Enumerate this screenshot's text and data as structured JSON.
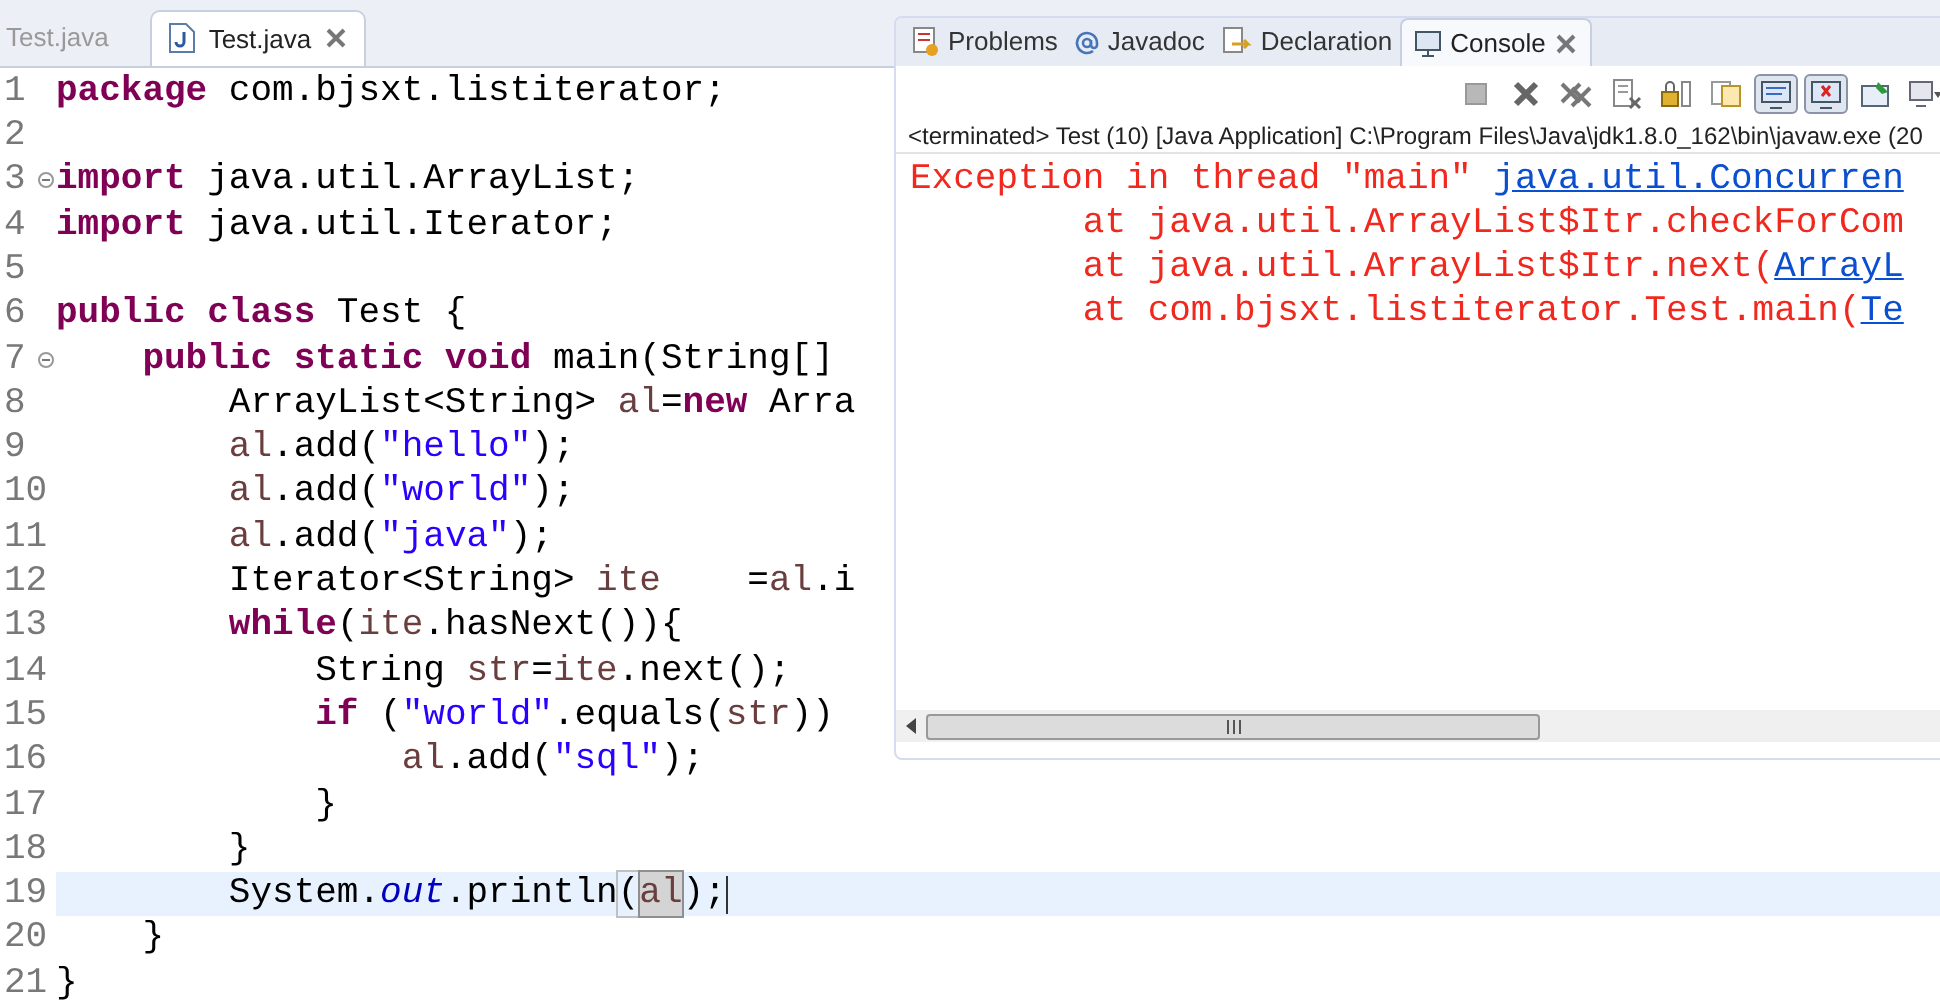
{
  "editor": {
    "tabs": [
      {
        "label": "Test.java",
        "selected": false
      },
      {
        "label": "Test.java",
        "selected": true
      }
    ],
    "lines": [
      {
        "number": "1",
        "fold": false,
        "current": false,
        "tokens": [
          {
            "kind": "keyword",
            "text": "package"
          },
          {
            "kind": "plain",
            "text": " com.bjsxt.listiterator;"
          }
        ]
      },
      {
        "number": "2",
        "fold": false,
        "current": false
      },
      {
        "number": "3",
        "fold": true,
        "current": false,
        "tokens": [
          {
            "kind": "keyword",
            "text": "import"
          },
          {
            "kind": "plain",
            "text": " java.util.ArrayList;"
          }
        ]
      },
      {
        "number": "4",
        "fold": false,
        "current": false,
        "tokens": [
          {
            "kind": "keyword",
            "text": "import"
          },
          {
            "kind": "plain",
            "text": " java.util.Iterator;"
          }
        ]
      },
      {
        "number": "5",
        "fold": false,
        "current": false
      },
      {
        "number": "6",
        "fold": false,
        "current": false,
        "tokens": [
          {
            "kind": "keyword",
            "text": "public class"
          },
          {
            "kind": "plain",
            "text": " Test {"
          }
        ]
      },
      {
        "number": "7",
        "fold": true,
        "current": false,
        "tokens": [
          {
            "kind": "keyword",
            "text": "    public static void"
          },
          {
            "kind": "plain",
            "text": " main(String[]"
          }
        ]
      },
      {
        "number": "8",
        "fold": false,
        "current": false,
        "tokens": [
          {
            "kind": "plain",
            "text": "        ArrayList<String> "
          },
          {
            "kind": "local",
            "text": "al"
          },
          {
            "kind": "plain",
            "text": "="
          },
          {
            "kind": "keyword",
            "text": "new"
          },
          {
            "kind": "plain",
            "text": " Arra"
          }
        ]
      },
      {
        "number": "9",
        "fold": false,
        "current": false,
        "tokens": [
          {
            "kind": "local",
            "text": "        al"
          },
          {
            "kind": "plain",
            "text": ".add("
          },
          {
            "kind": "string",
            "text": "\"hello\""
          },
          {
            "kind": "plain",
            "text": ");"
          }
        ]
      },
      {
        "number": "10",
        "fold": false,
        "current": false,
        "tokens": [
          {
            "kind": "local",
            "text": "        al"
          },
          {
            "kind": "plain",
            "text": ".add("
          },
          {
            "kind": "string",
            "text": "\"world\""
          },
          {
            "kind": "plain",
            "text": ");"
          }
        ]
      },
      {
        "number": "11",
        "fold": false,
        "current": false,
        "tokens": [
          {
            "kind": "local",
            "text": "        al"
          },
          {
            "kind": "plain",
            "text": ".add("
          },
          {
            "kind": "string",
            "text": "\"java\""
          },
          {
            "kind": "plain",
            "text": ");"
          }
        ]
      },
      {
        "number": "12",
        "fold": false,
        "current": false,
        "tokens": [
          {
            "kind": "plain",
            "text": "        Iterator<String> "
          },
          {
            "kind": "local",
            "text": "ite"
          },
          {
            "kind": "plain",
            "text": "    ="
          },
          {
            "kind": "local",
            "text": "al"
          },
          {
            "kind": "plain",
            "text": ".i"
          }
        ]
      },
      {
        "number": "13",
        "fold": false,
        "current": false,
        "tokens": [
          {
            "kind": "keyword",
            "text": "        while"
          },
          {
            "kind": "plain",
            "text": "("
          },
          {
            "kind": "local",
            "text": "ite"
          },
          {
            "kind": "plain",
            "text": ".hasNext()){"
          }
        ]
      },
      {
        "number": "14",
        "fold": false,
        "current": false,
        "tokens": [
          {
            "kind": "plain",
            "text": "            String "
          },
          {
            "kind": "local",
            "text": "str"
          },
          {
            "kind": "plain",
            "text": "="
          },
          {
            "kind": "local",
            "text": "ite"
          },
          {
            "kind": "plain",
            "text": ".next();"
          }
        ]
      },
      {
        "number": "15",
        "fold": false,
        "current": false,
        "tokens": [
          {
            "kind": "keyword",
            "text": "            if"
          },
          {
            "kind": "plain",
            "text": " ("
          },
          {
            "kind": "string",
            "text": "\"world\""
          },
          {
            "kind": "plain",
            "text": ".equals("
          },
          {
            "kind": "local",
            "text": "str"
          },
          {
            "kind": "plain",
            "text": "))"
          }
        ]
      },
      {
        "number": "16",
        "fold": false,
        "current": false,
        "tokens": [
          {
            "kind": "local",
            "text": "                al"
          },
          {
            "kind": "plain",
            "text": ".add("
          },
          {
            "kind": "string",
            "text": "\"sql\""
          },
          {
            "kind": "plain",
            "text": ");"
          }
        ]
      },
      {
        "number": "17",
        "fold": false,
        "current": false,
        "tokens": [
          {
            "kind": "plain",
            "text": "            }"
          }
        ]
      },
      {
        "number": "18",
        "fold": false,
        "current": false,
        "tokens": [
          {
            "kind": "plain",
            "text": "        }"
          }
        ]
      },
      {
        "number": "19",
        "fold": false,
        "current": true,
        "tokens": [
          {
            "kind": "plain",
            "text": "        System."
          },
          {
            "kind": "static",
            "text": "out"
          },
          {
            "kind": "plain",
            "text": ".println"
          },
          {
            "kind": "bracket",
            "text": "("
          },
          {
            "kind": "occurrence",
            "text": "al"
          },
          {
            "kind": "plain",
            "text": ");"
          }
        ]
      },
      {
        "number": "20",
        "fold": false,
        "current": false,
        "tokens": [
          {
            "kind": "plain",
            "text": "    }"
          }
        ]
      },
      {
        "number": "21",
        "fold": false,
        "current": false,
        "tokens": [
          {
            "kind": "plain",
            "text": "}"
          }
        ]
      }
    ]
  },
  "console": {
    "tabs": [
      {
        "kind": "problems",
        "label": "Problems",
        "selected": false
      },
      {
        "kind": "javadoc",
        "label": "Javadoc",
        "selected": false
      },
      {
        "kind": "declaration",
        "label": "Declaration",
        "selected": false
      },
      {
        "kind": "console",
        "label": "Console",
        "selected": true
      }
    ],
    "toolbar": [
      {
        "kind": "stop",
        "pressed": false
      },
      {
        "kind": "remove",
        "pressed": false
      },
      {
        "kind": "remove-all",
        "pressed": false
      },
      {
        "kind": "clear",
        "pressed": false
      },
      {
        "kind": "scroll-lock",
        "pressed": false
      },
      {
        "kind": "copy",
        "pressed": false
      },
      {
        "kind": "show-on-output",
        "pressed": true
      },
      {
        "kind": "show-on-error",
        "pressed": true
      },
      {
        "kind": "pin",
        "pressed": false
      },
      {
        "kind": "display",
        "pressed": false
      }
    ],
    "status": "<terminated> Test (10) [Java Application] C:\\Program Files\\Java\\jdk1.8.0_162\\bin\\javaw.exe (20",
    "output": [
      {
        "segments": [
          {
            "kind": "error",
            "text": "Exception in thread \"main\" "
          },
          {
            "kind": "link",
            "text": "java.util.Concurren"
          }
        ]
      },
      {
        "segments": [
          {
            "kind": "error",
            "text": "        at java.util.ArrayList$Itr.checkForCom"
          }
        ]
      },
      {
        "segments": [
          {
            "kind": "error",
            "text": "        at java.util.ArrayList$Itr.next("
          },
          {
            "kind": "link",
            "text": "ArrayL"
          }
        ]
      },
      {
        "segments": [
          {
            "kind": "error",
            "text": "        at com.bjsxt.listiterator.Test.main("
          },
          {
            "kind": "link",
            "text": "Te"
          }
        ]
      }
    ]
  }
}
